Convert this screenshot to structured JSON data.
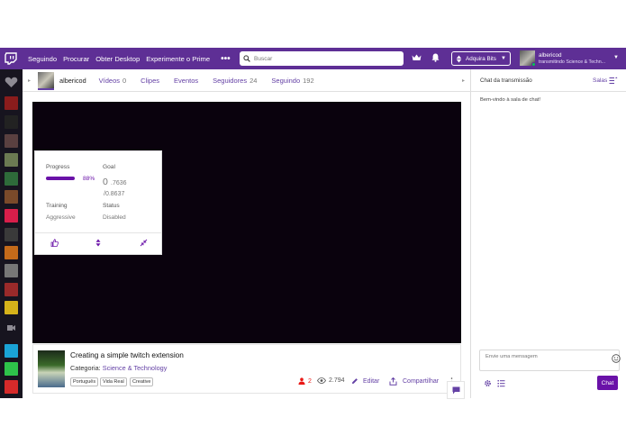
{
  "topbar": {
    "nav": [
      "Seguindo",
      "Procurar",
      "Obter Desktop",
      "Experimente o Prime"
    ],
    "more": "•••",
    "search_placeholder": "Buscar",
    "bits_label": "Adquira Bits",
    "user_name": "albericod",
    "user_status": "transmitindo Science & Techn..."
  },
  "channel": {
    "name": "albericod",
    "tabs": [
      {
        "label": "Vídeos",
        "count": "0"
      },
      {
        "label": "Clipes",
        "count": ""
      },
      {
        "label": "Eventos",
        "count": ""
      },
      {
        "label": "Seguidores",
        "count": "24"
      },
      {
        "label": "Seguindo",
        "count": "192"
      }
    ]
  },
  "extension": {
    "progress_label": "Progress",
    "progress_value": 0.88,
    "progress_text": "88%",
    "goal_label": "Goal",
    "goal_big": "0",
    "goal_small": ".7636",
    "goal_sub": "/0.8637",
    "training_label": "Training",
    "training_value": "Aggressive",
    "status_label": "Status",
    "status_value": "Disabled"
  },
  "stream": {
    "title": "Creating a simple twitch extension",
    "category_prefix": "Categoria:",
    "category": "Science & Technology",
    "tags": [
      "Português",
      "Vida Real",
      "Creative"
    ],
    "viewers": "2",
    "views": "2.794",
    "edit_label": "Editar",
    "share_label": "Compartilhar"
  },
  "chat": {
    "title": "Chat da transmissão",
    "rooms_label": "Salas",
    "welcome": "Bem-vindo à sala de chat!",
    "input_placeholder": "Envie uma mensagem",
    "send_label": "Chat"
  },
  "colors": {
    "brand": "#6441a5",
    "topbar": "#5e2f95",
    "accent": "#6a12a8",
    "live_red": "#e91916"
  }
}
